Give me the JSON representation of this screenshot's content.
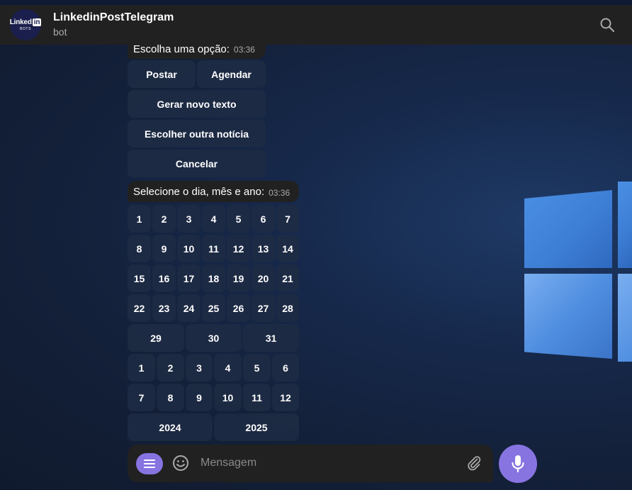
{
  "header": {
    "title": "LinkedinPostTelegram",
    "subtitle": "bot",
    "avatar_brand": "Linked",
    "avatar_brand_box": "in",
    "avatar_sub": "BOTS"
  },
  "messages": [
    {
      "text": "Escolha uma opção:",
      "time": "03:36"
    },
    {
      "text": "Selecione o dia, mês e ano:",
      "time": "03:36"
    }
  ],
  "options_keyboard": {
    "rows": [
      [
        "Postar",
        "Agendar"
      ],
      [
        "Gerar novo texto"
      ],
      [
        "Escolher outra notícia"
      ],
      [
        "Cancelar"
      ]
    ]
  },
  "date_keyboard": {
    "days_rows": [
      [
        "1",
        "2",
        "3",
        "4",
        "5",
        "6",
        "7"
      ],
      [
        "8",
        "9",
        "10",
        "11",
        "12",
        "13",
        "14"
      ],
      [
        "15",
        "16",
        "17",
        "18",
        "19",
        "20",
        "21"
      ],
      [
        "22",
        "23",
        "24",
        "25",
        "26",
        "27",
        "28"
      ],
      [
        "29",
        "30",
        "31"
      ]
    ],
    "months_rows": [
      [
        "1",
        "2",
        "3",
        "4",
        "5",
        "6"
      ],
      [
        "7",
        "8",
        "9",
        "10",
        "11",
        "12"
      ]
    ],
    "years": [
      "2024",
      "2025"
    ]
  },
  "composer": {
    "placeholder": "Mensagem"
  },
  "icons": {
    "search": "search-icon",
    "menu": "menu-icon",
    "emoji": "emoji-icon",
    "attach": "paperclip-icon",
    "mic": "microphone-icon"
  },
  "colors": {
    "accent": "#8774e1",
    "header": "#212121",
    "bubble": "#212121"
  }
}
